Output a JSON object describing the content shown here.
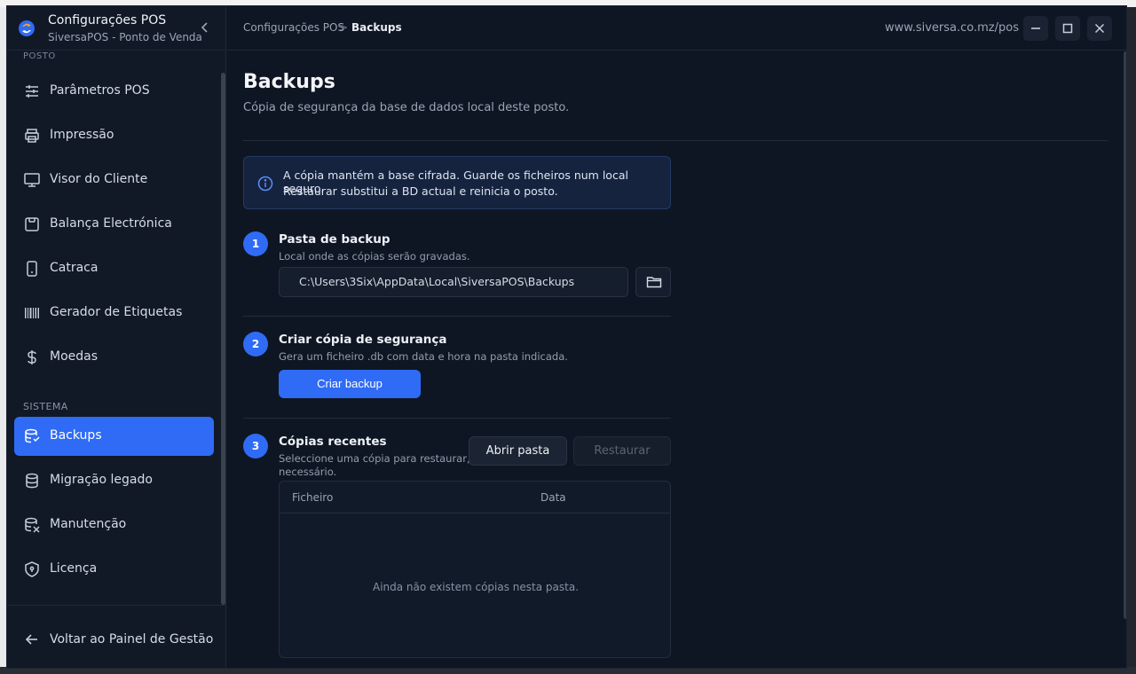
{
  "brand": {
    "title": "Configurações POS",
    "subtitle": "SiversaPOS - Ponto de Venda",
    "collapse_icon": "chevron-left-icon"
  },
  "sidebar": {
    "cut_section": "POSTO",
    "items": [
      {
        "label": "Parâmetros POS",
        "icon": "sliders-icon"
      },
      {
        "label": "Impressão",
        "icon": "printer-icon"
      },
      {
        "label": "Visor do Cliente",
        "icon": "monitor-icon"
      },
      {
        "label": "Balança Electrónica",
        "icon": "scale-icon"
      },
      {
        "label": "Catraca",
        "icon": "tablet-icon"
      },
      {
        "label": "Gerador de Etiquetas",
        "icon": "barcode-icon"
      },
      {
        "label": "Moedas",
        "icon": "dollar-icon"
      }
    ],
    "system_section": "SISTEMA",
    "system_items": [
      {
        "label": "Backups",
        "icon": "database-icon",
        "active": true
      },
      {
        "label": "Migração legado",
        "icon": "database-migrate-icon"
      },
      {
        "label": "Manutenção",
        "icon": "database-wrench-icon"
      },
      {
        "label": "Licença",
        "icon": "shield-icon"
      }
    ],
    "back_label": "Voltar ao Painel de Gestão"
  },
  "topbar": {
    "breadcrumb": [
      "Configurações POS",
      "Backups"
    ],
    "separator": ">",
    "url": "www.siversa.co.mz/pos",
    "window_buttons": [
      "minimize-icon",
      "maximize-icon",
      "close-icon"
    ]
  },
  "main": {
    "title": "Backups",
    "subtitle": "Cópia de segurança da base de dados local deste posto.",
    "info": {
      "line1": "A cópia mantém a base cifrada. Guarde os ficheiros num local seguro.",
      "line2": "Restaurar substitui a BD actual e reinicia o posto."
    },
    "steps": [
      {
        "number": "1",
        "title": "Pasta de backup",
        "desc": "Local onde as cópias serão gravadas.",
        "path_value": "C:\\Users\\3Six\\AppData\\Local\\SiversaPOS\\Backups"
      },
      {
        "number": "2",
        "title": "Criar cópia de segurança",
        "desc": "Gera um ficheiro .db com data e hora na pasta indicada.",
        "button": "Criar backup"
      },
      {
        "number": "3",
        "title": "Cópias recentes",
        "desc_line1": "Seleccione uma cópia para restaurar, se",
        "desc_line2": "necessário.",
        "open_button": "Abrir pasta",
        "restore_button": "Restaurar",
        "table": {
          "columns": [
            "Ficheiro",
            "Data"
          ],
          "rows": [],
          "empty": "Ainda não existem cópias nesta pasta."
        }
      }
    ]
  },
  "colors": {
    "accent": "#2f6bf5",
    "background": "#0f1623",
    "sidebar": "#111927"
  }
}
